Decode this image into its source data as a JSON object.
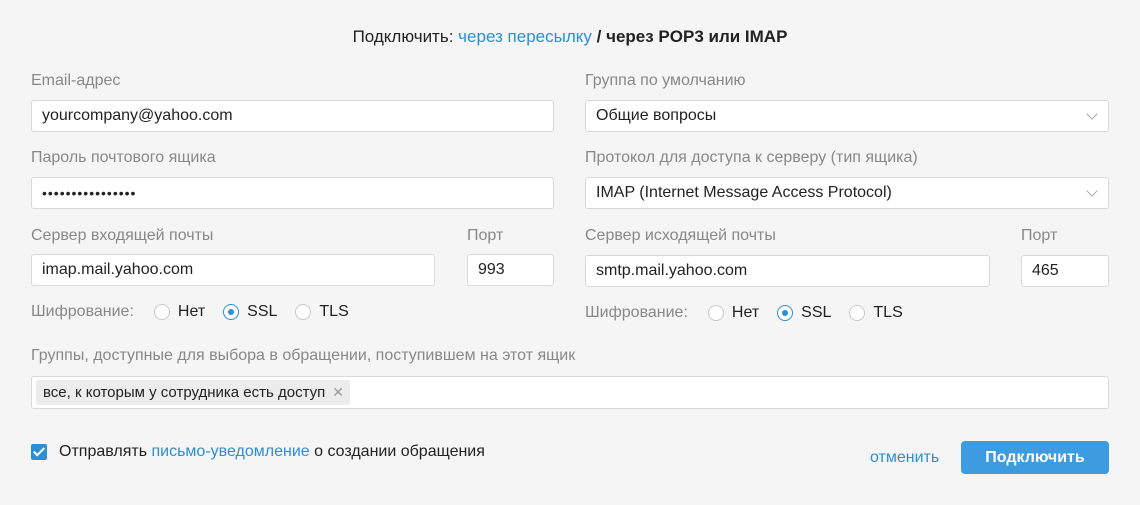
{
  "header": {
    "prefix": "Подключить:",
    "option_forward": "через пересылку",
    "separator": "/",
    "option_pop3_imap": "через POP3 или IMAP"
  },
  "email": {
    "label": "Email-адрес",
    "value": "yourcompany@yahoo.com"
  },
  "default_group": {
    "label": "Группа по умолчанию",
    "value": "Общие вопросы"
  },
  "password": {
    "label": "Пароль почтового ящика",
    "value": "••••••••••••••••"
  },
  "protocol": {
    "label": "Протокол для доступа к серверу (тип ящика)",
    "value": "IMAP (Internet Message Access Protocol)"
  },
  "incoming": {
    "server_label": "Сервер входящей почты",
    "server_value": "imap.mail.yahoo.com",
    "port_label": "Порт",
    "port_value": "993",
    "encryption_label": "Шифрование:",
    "options": [
      "Нет",
      "SSL",
      "TLS"
    ],
    "selected": "SSL"
  },
  "outgoing": {
    "server_label": "Сервер исходящей почты",
    "server_value": "smtp.mail.yahoo.com",
    "port_label": "Порт",
    "port_value": "465",
    "encryption_label": "Шифрование:",
    "options": [
      "Нет",
      "SSL",
      "TLS"
    ],
    "selected": "SSL"
  },
  "groups": {
    "label": "Группы, доступные для выбора в обращении, поступившем на этот ящик",
    "tags": [
      "все, к которым у сотрудника есть доступ"
    ],
    "remove_glyph": "✕"
  },
  "notification": {
    "checked": true,
    "text_before": "Отправлять",
    "link": "письмо-уведомление",
    "text_after": "о создании обращения"
  },
  "actions": {
    "cancel": "отменить",
    "connect": "Подключить"
  },
  "colors": {
    "accent": "#2b8fd6",
    "button": "#3d9be0",
    "background": "#f5f5f5"
  }
}
